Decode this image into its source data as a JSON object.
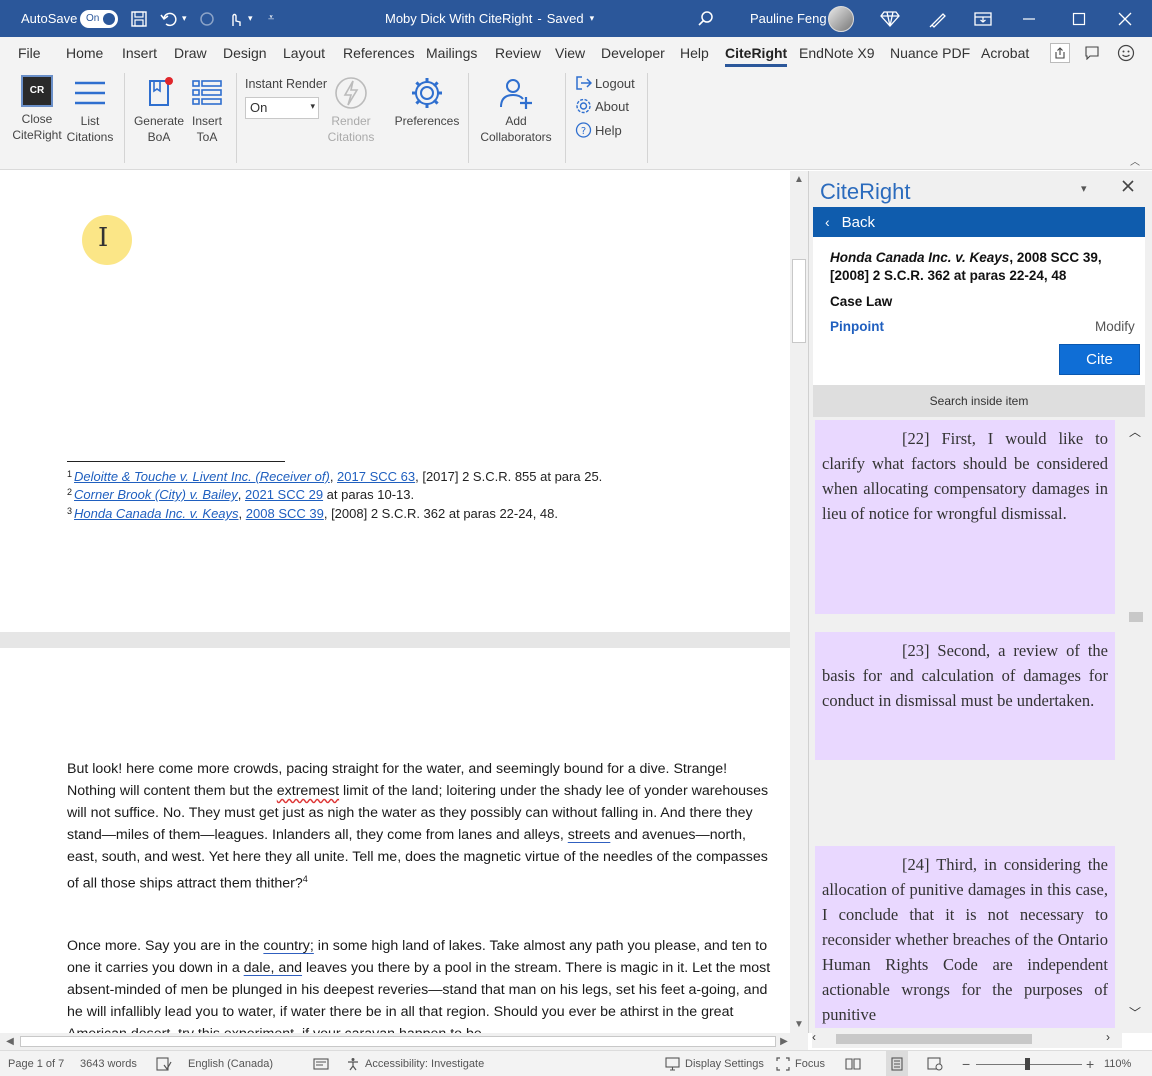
{
  "titlebar": {
    "autosave_label": "AutoSave",
    "autosave_state": "On",
    "doc_title": "Moby Dick With CiteRight",
    "saved_status": "Saved",
    "user_name": "Pauline Feng"
  },
  "tabs": [
    {
      "label": "File"
    },
    {
      "label": "Home"
    },
    {
      "label": "Insert"
    },
    {
      "label": "Draw"
    },
    {
      "label": "Design"
    },
    {
      "label": "Layout"
    },
    {
      "label": "References"
    },
    {
      "label": "Mailings"
    },
    {
      "label": "Review"
    },
    {
      "label": "View"
    },
    {
      "label": "Developer"
    },
    {
      "label": "Help"
    },
    {
      "label": "CiteRight"
    },
    {
      "label": "EndNote X9"
    },
    {
      "label": "Nuance PDF"
    },
    {
      "label": "Acrobat"
    }
  ],
  "ribbon": {
    "close": {
      "line1": "Close",
      "line2": "CiteRight",
      "icon_text": "CR"
    },
    "list": {
      "line1": "List",
      "line2": "Citations"
    },
    "generate": {
      "line1": "Generate",
      "line2": "BoA"
    },
    "insert_toa": {
      "line1": "Insert",
      "line2": "ToA"
    },
    "instant_render_label": "Instant Render",
    "instant_render_value": "On",
    "render": {
      "line1": "Render",
      "line2": "Citations"
    },
    "preferences": "Preferences",
    "collaborators": {
      "line1": "Add",
      "line2": "Collaborators"
    },
    "logout": "Logout",
    "about": "About",
    "help": "Help"
  },
  "document": {
    "footnotes": [
      {
        "num": "1",
        "case": "Deloitte & Touche v. Livent Inc. (Receiver of)",
        "cite": "2017 SCC 63",
        "rest": ", [2017] 2 S.C.R. 855 at para 25."
      },
      {
        "num": "2",
        "case": "Corner Brook (City) v. Bailey",
        "cite": "2021 SCC 29",
        "rest": " at paras 10-13."
      },
      {
        "num": "3",
        "case": "Honda Canada Inc. v. Keays",
        "cite": "2008 SCC 39",
        "rest": ", [2008] 2 S.C.R. 362 at paras 22-24, 48."
      }
    ],
    "p1": {
      "a": "But look! here come more crowds, pacing straight for the water, and seemingly bound for a dive. Strange! Nothing will content them but the ",
      "b": "extremest",
      "c": " limit of the land; loitering under the shady lee of yonder warehouses will not suffice. No. They must get just as nigh the water as they possibly can without falling in. And there they stand—miles of them—leagues. Inlanders all, they come from lanes and alleys, ",
      "d": "streets",
      "e": " and avenues—north, east, south, and west. Yet here they all unite. Tell me, does the magnetic virtue of the needles of the compasses of all those ships attract them thither?",
      "sup": "4"
    },
    "p2": {
      "a": "Once more. Say you are in the ",
      "b": "country;",
      "c": " in some high land of lakes. Take almost any path you please, and ten to one it carries you down in a ",
      "d": "dale, and",
      "e": " leaves you there by a pool in the stream. There is magic in it. Let the most absent-minded of men be plunged in his deepest reveries—stand that man on his legs, set his feet a-going, and he will infallibly lead you to water, if water there be in all that region. Should you ever be athirst in the great American desert, try this experiment, if your caravan happen to be"
    }
  },
  "pane": {
    "title": "CiteRight",
    "back": "Back",
    "citation_case": "Honda Canada Inc. v. Keays",
    "citation_rest": ", 2008 SCC 39, [2008] 2 S.C.R. 362 at paras 22-24, 48",
    "type": "Case Law",
    "pinpoint": "Pinpoint",
    "modify": "Modify",
    "cite": "Cite",
    "search": "Search inside item",
    "paragraphs": [
      {
        "text": "[22] First, I would like to clarify what factors should be considered when allocating compensatory damages in lieu of notice for wrongful dismissal."
      },
      {
        "text": "[23] Second, a review of the basis for and calculation of damages for conduct in dismissal must be undertaken."
      },
      {
        "text": "[24] Third, in considering the allocation of punitive damages in this case, I conclude that it is not necessary to reconsider whether breaches of the Ontario Human Rights Code are independent actionable wrongs for the purposes of punitive"
      }
    ]
  },
  "status": {
    "page": "Page 1 of 7",
    "words": "3643 words",
    "language": "English (Canada)",
    "accessibility": "Accessibility: Investigate",
    "display": "Display Settings",
    "focus": "Focus",
    "zoom": "110%"
  },
  "colors": {
    "word_blue": "#2b579a",
    "pane_header": "#0f5cad",
    "highlight": "#e9d8ff",
    "link": "#1f5fbf"
  }
}
